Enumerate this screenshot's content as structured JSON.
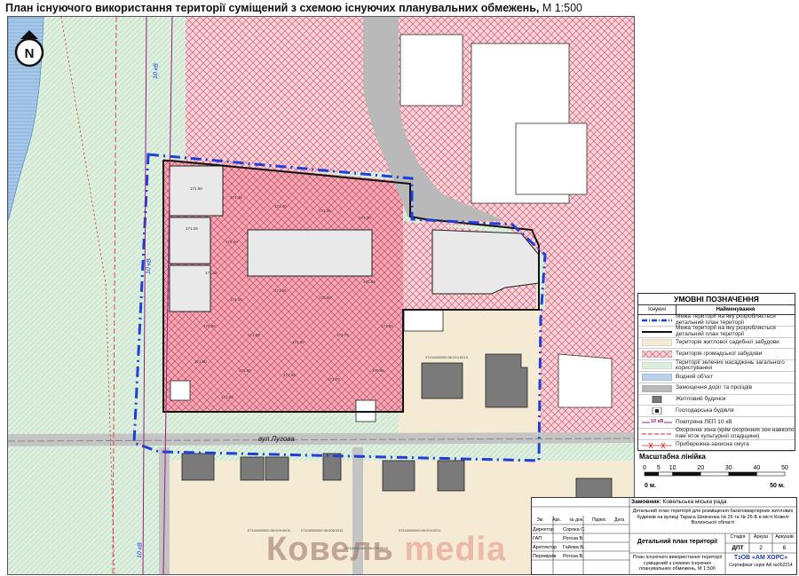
{
  "title": {
    "main": "План існуючого використання території суміщений з схемою існуючих планувальних обмежень,",
    "scale": "М 1:500"
  },
  "north": {
    "letter": "N"
  },
  "map": {
    "street": "вул.Лугова",
    "power_label": "10 кВ",
    "elevations": [
      "171.50",
      "171.45",
      "171.40",
      "171.35",
      "171.30",
      "171.25",
      "171.20",
      "171.15",
      "171.10",
      "171.05",
      "170.90",
      "170.85",
      "170.80",
      "171.55",
      "171.60",
      "171.75",
      "171.85",
      "171.90",
      "171.80",
      "171.65",
      "171.70",
      "170.95",
      "171.00"
    ],
    "parcels": [
      "07104080000:06:010:0015",
      "07104080000:06:009:0009",
      "07104080000:06:008:0011",
      "07104080000:06:008:0015",
      "07104080000:06:004:0011"
    ]
  },
  "legend": {
    "title": "УМОВНІ ПОЗНАЧЕННЯ",
    "col_existing": "Існуючі",
    "col_name": "Найменування",
    "items": [
      {
        "sym": "blue-dash",
        "text": "Межа території на яку розробляється детальний план території"
      },
      {
        "sym": "black-line",
        "text": "Межа території на яку розробляється детальний план території"
      },
      {
        "sym": "beige",
        "text": "Територія житлової садибної забудови"
      },
      {
        "sym": "pink-hatch",
        "text": "Територія громадської забудови"
      },
      {
        "sym": "green",
        "text": "Території зелених насаджень загального користування"
      },
      {
        "sym": "water",
        "text": "Водний об'єкт"
      },
      {
        "sym": "grey",
        "text": "Замощення доріг та проїздів"
      },
      {
        "sym": "house",
        "text": "Житловий будинок"
      },
      {
        "sym": "shed",
        "text": "Господарська будівля"
      },
      {
        "sym": "power",
        "text": "Повітряна ЛЕП 10 кВ",
        "code": "10 кВ"
      },
      {
        "sym": "zone",
        "text": "Охоронна зона (крім охоронних зон навколо пам`яток культурної спадщини)"
      },
      {
        "sym": "redx",
        "text": "Прибережна-захисна смуга"
      }
    ]
  },
  "scalebar": {
    "title": "Масштабна лінійка",
    "ticks": [
      "0",
      "5",
      "10",
      "20",
      "30",
      "40",
      "50"
    ],
    "left_label": "0 м.",
    "right_label": "50 м."
  },
  "stamp": {
    "customer_label": "Замовник:",
    "customer": "Ковельська міська рада",
    "project": "Детальний план території для розміщення багатоквартирних житлових будинків на вулиці Тараса Шевченка № 26 та № 26-Б в місті Ковелі Волинської області",
    "header_cols": [
      "Зм.",
      "Арк.",
      "№ док.",
      "Підпис",
      "Дата"
    ],
    "staff": [
      {
        "role": "Директор",
        "name": "Сорока С."
      },
      {
        "role": "ГАП",
        "name": "Рогоза В."
      },
      {
        "role": "Архітектор",
        "name": "Гайова В."
      },
      {
        "role": "Перевірив",
        "name": "Рогоза В."
      }
    ],
    "doc_name": "Детальний план території",
    "stage_label": "Стадія",
    "sheet_label": "Аркуш",
    "sheets_label": "Аркушів",
    "stage": "ДПТ",
    "sheet": "2",
    "sheets": "6",
    "sheet_title": "План існуючого використання території суміщений з схемою існуючих планувальних обмежень, М 1:500",
    "company": "ТзОВ «АМ ХОРС»",
    "cert": "Сертифікат серія АА №002214"
  },
  "watermark": {
    "part1": "Ковель",
    "part2": "media"
  },
  "colors": {
    "pink": "#f4c9cf",
    "hatch": "#d9415a",
    "beige": "#f5ead3",
    "green": "#dcefdc",
    "water": "#b9d3ec",
    "road": "#b9b9b9",
    "boundary_blue": "#1f3fd6",
    "building": "#7a7a7a"
  }
}
